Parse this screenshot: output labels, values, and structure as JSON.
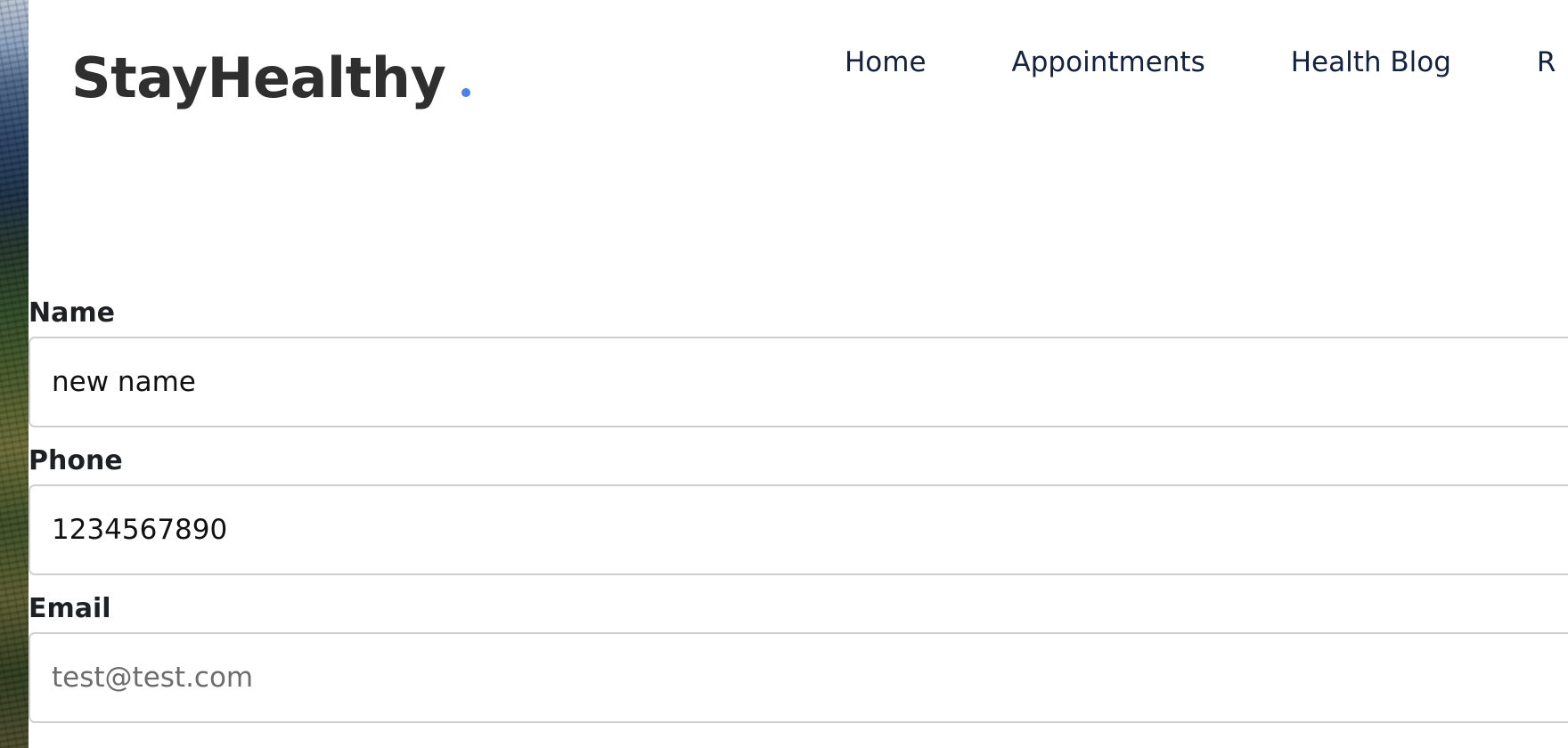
{
  "header": {
    "logo_text": "StayHealthy",
    "nav": [
      {
        "label": "Home"
      },
      {
        "label": "Appointments"
      },
      {
        "label": "Health Blog"
      },
      {
        "label": "R"
      }
    ]
  },
  "form": {
    "name": {
      "label": "Name",
      "value": "new name"
    },
    "phone": {
      "label": "Phone",
      "value": "1234567890"
    },
    "email": {
      "label": "Email",
      "value": "",
      "placeholder": "test@test.com"
    }
  },
  "colors": {
    "accent": "#4a80ec",
    "nav_text": "#13233f",
    "logo_text": "#2f2f2f"
  }
}
